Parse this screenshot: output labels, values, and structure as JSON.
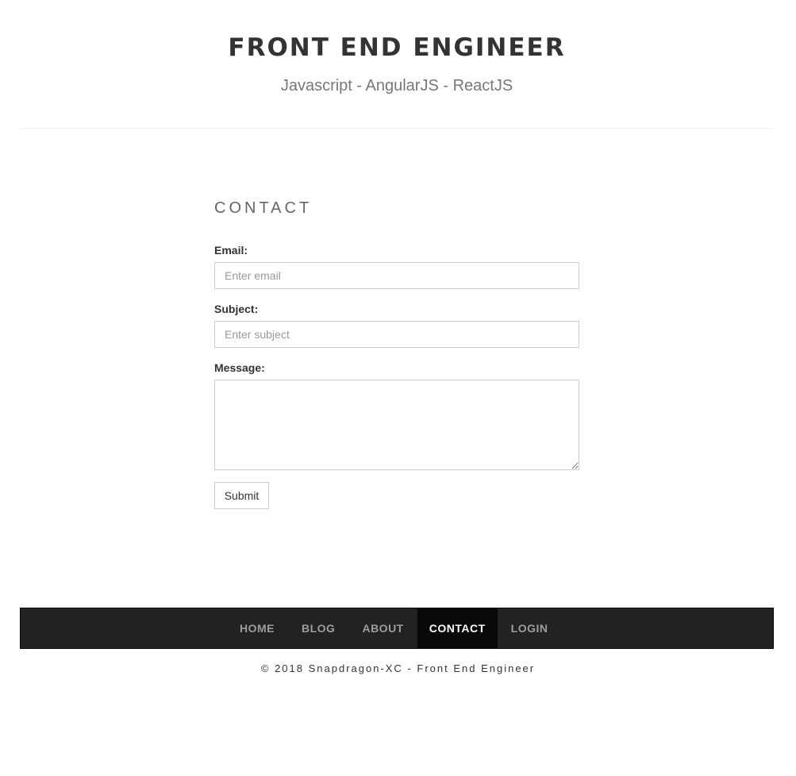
{
  "header": {
    "title": "FRONT END ENGINEER",
    "tagline": "Javascript - AngularJS - ReactJS"
  },
  "contact": {
    "heading": "CONTACT",
    "email": {
      "label": "Email:",
      "placeholder": "Enter email",
      "value": ""
    },
    "subject": {
      "label": "Subject:",
      "placeholder": "Enter subject",
      "value": ""
    },
    "message": {
      "label": "Message:",
      "value": ""
    },
    "submit_label": "Submit"
  },
  "nav": {
    "items": [
      {
        "label": "HOME",
        "active": false
      },
      {
        "label": "BLOG",
        "active": false
      },
      {
        "label": "ABOUT",
        "active": false
      },
      {
        "label": "CONTACT",
        "active": true
      },
      {
        "label": "LOGIN",
        "active": false
      }
    ]
  },
  "footer": {
    "copyright": "© 2018 Snapdragon-XC - Front End Engineer"
  },
  "colors": {
    "navbar_background": "#222222",
    "nav_active_background": "#080808",
    "nav_text": "#9d9d9d",
    "nav_active_text": "#ffffff"
  }
}
